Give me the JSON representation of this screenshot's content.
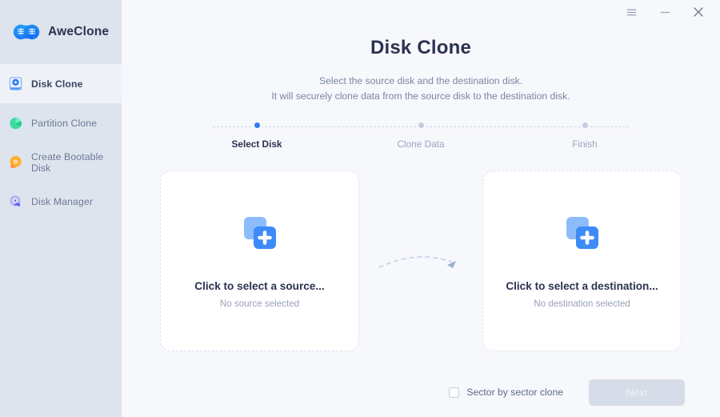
{
  "titlebar": {
    "menu_label": "☰",
    "minimize_label": "–",
    "close_label": "✕",
    "menu_icon": "hamburger-menu-icon",
    "minimize_icon": "minimize-icon",
    "close_icon": "close-icon"
  },
  "sidebar": {
    "brand": {
      "name": "AweClone",
      "logo_icon": "infinity-logo-icon"
    },
    "items": [
      {
        "label": "Disk Clone",
        "icon": "disk-clone-icon",
        "active": true
      },
      {
        "label": "Partition Clone",
        "icon": "partition-clone-icon",
        "active": false
      },
      {
        "label": "Create Bootable Disk",
        "icon": "create-bootable-disk-icon",
        "active": false
      },
      {
        "label": "Disk Manager",
        "icon": "disk-manager-icon",
        "active": false
      }
    ]
  },
  "header": {
    "title": "Disk Clone",
    "subtitle_line1": "Select the source disk and the destination disk.",
    "subtitle_line2": "It will securely clone data from the source disk to the destination disk."
  },
  "stepper": {
    "steps": [
      {
        "label": "Select Disk",
        "state": "active"
      },
      {
        "label": "Clone Data",
        "state": "pending"
      },
      {
        "label": "Finish",
        "state": "pending"
      }
    ]
  },
  "cards": {
    "source": {
      "title": "Click to select a source...",
      "subtitle": "No source selected",
      "icon": "add-disk-plus-icon"
    },
    "destination": {
      "title": "Click to select a destination...",
      "subtitle": "No destination selected",
      "icon": "add-disk-plus-icon"
    },
    "connector_icon": "dashed-arrow-icon"
  },
  "footer": {
    "checkbox_label": "Sector by sector clone",
    "checkbox_checked": false,
    "next_label": "Next",
    "next_disabled": true
  },
  "colors": {
    "accent": "#2f7bf6",
    "sidebar_bg": "#dde4ee",
    "main_bg": "#f7f8fc",
    "active_row_bg": "#eef1f7",
    "title_text": "#2b3350",
    "muted_text": "#98a2b9",
    "card_border": "#dbe2ee",
    "next_disabled_bg": "#d7dde8"
  }
}
